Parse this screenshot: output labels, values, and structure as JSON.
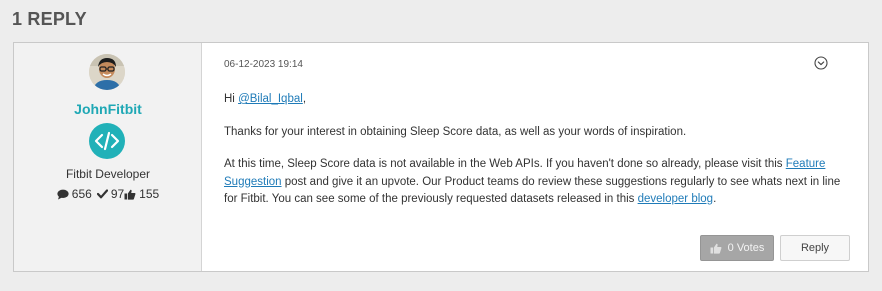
{
  "thread": {
    "replies_heading": "1 REPLY"
  },
  "author": {
    "name": "JohnFitbit",
    "role": "Fitbit Developer",
    "avatar_icon": "user-avatar-photo",
    "role_badge_icon": "code-brackets-icon",
    "stats": {
      "posts": "656",
      "solutions": "97",
      "kudos": "155"
    }
  },
  "post": {
    "timestamp": "06-12-2023 19:14",
    "menu_icon": "chevron-down-circle-icon",
    "greeting_prefix": "Hi ",
    "mention": "@Bilal_Iqbal",
    "greeting_suffix": ",",
    "paragraph_1": "Thanks for your interest in obtaining Sleep Score data, as well as your words of inspiration.",
    "paragraph_2_start": "At this time, Sleep Score data is not available in the Web APIs. If you haven't done so already, please visit this ",
    "link_feature_suggestion": "Feature Suggestion",
    "paragraph_2_middle": " post and give it an upvote. Our Product teams do review these suggestions regularly to see whats next in line for Fitbit. You can see some of the previously requested datasets released in this ",
    "link_developer_blog": "developer blog",
    "paragraph_2_end": "."
  },
  "actions": {
    "votes_label": "0 Votes",
    "reply_label": "Reply"
  },
  "colors": {
    "brand_teal": "#1fa8b5",
    "link_blue": "#1f7bb8",
    "badge_teal": "#21b1b8",
    "disabled_button": "#a6a6a6"
  }
}
